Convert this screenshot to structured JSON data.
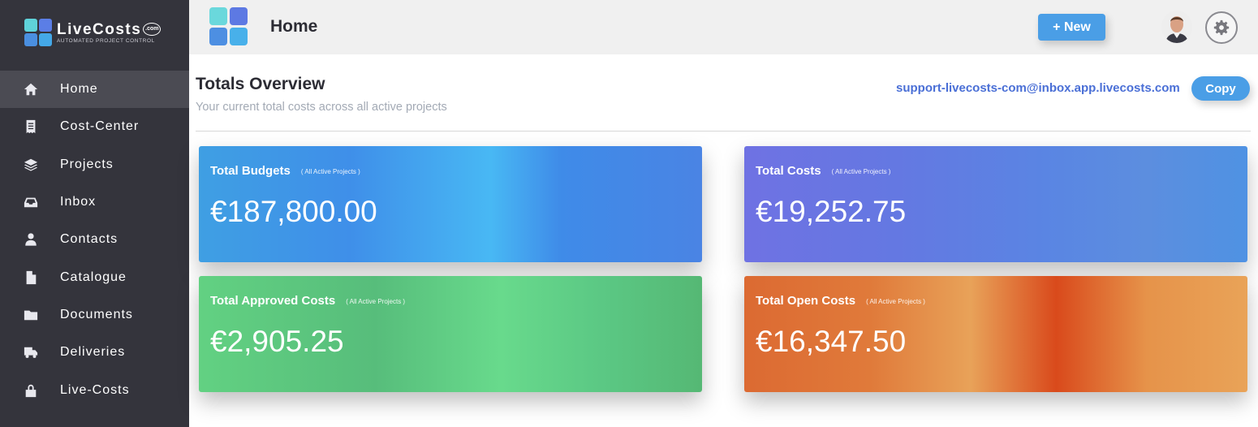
{
  "brand": {
    "name": "LiveCosts",
    "com": ".com",
    "tagline": "AUTOMATED PROJECT CONTROL"
  },
  "sidebar": {
    "items": [
      {
        "label": "Home",
        "icon": "home-icon",
        "active": true
      },
      {
        "label": "Cost-Center",
        "icon": "receipt-icon",
        "active": false
      },
      {
        "label": "Projects",
        "icon": "layers-icon",
        "active": false
      },
      {
        "label": "Inbox",
        "icon": "inbox-icon",
        "active": false
      },
      {
        "label": "Contacts",
        "icon": "user-icon",
        "active": false
      },
      {
        "label": "Catalogue",
        "icon": "file-icon",
        "active": false
      },
      {
        "label": "Documents",
        "icon": "folder-icon",
        "active": false
      },
      {
        "label": "Deliveries",
        "icon": "truck-icon",
        "active": false
      },
      {
        "label": "Live-Costs",
        "icon": "lock-icon",
        "active": false
      }
    ]
  },
  "header": {
    "title": "Home",
    "new_label": "+ New"
  },
  "overview": {
    "title": "Totals Overview",
    "subtitle": "Your current total costs across all active projects",
    "support_email": "support-livecosts-com@inbox.app.livecosts.com",
    "copy_label": "Copy"
  },
  "cards": {
    "budgets": {
      "title": "Total Budgets",
      "note": "( All Active Projects )",
      "value": "€187,800.00"
    },
    "costs": {
      "title": "Total Costs",
      "note": "( All Active Projects )",
      "value": "€19,252.75"
    },
    "approved": {
      "title": "Total Approved Costs",
      "note": "( All Active Projects )",
      "value": "€2,905.25"
    },
    "open": {
      "title": "Total Open Costs",
      "note": "( All Active Projects )",
      "value": "€16,347.50"
    }
  },
  "colors": {
    "sidebar_bg": "#34343c",
    "accent": "#4a9ee6",
    "email_link": "#4a6fd6"
  }
}
